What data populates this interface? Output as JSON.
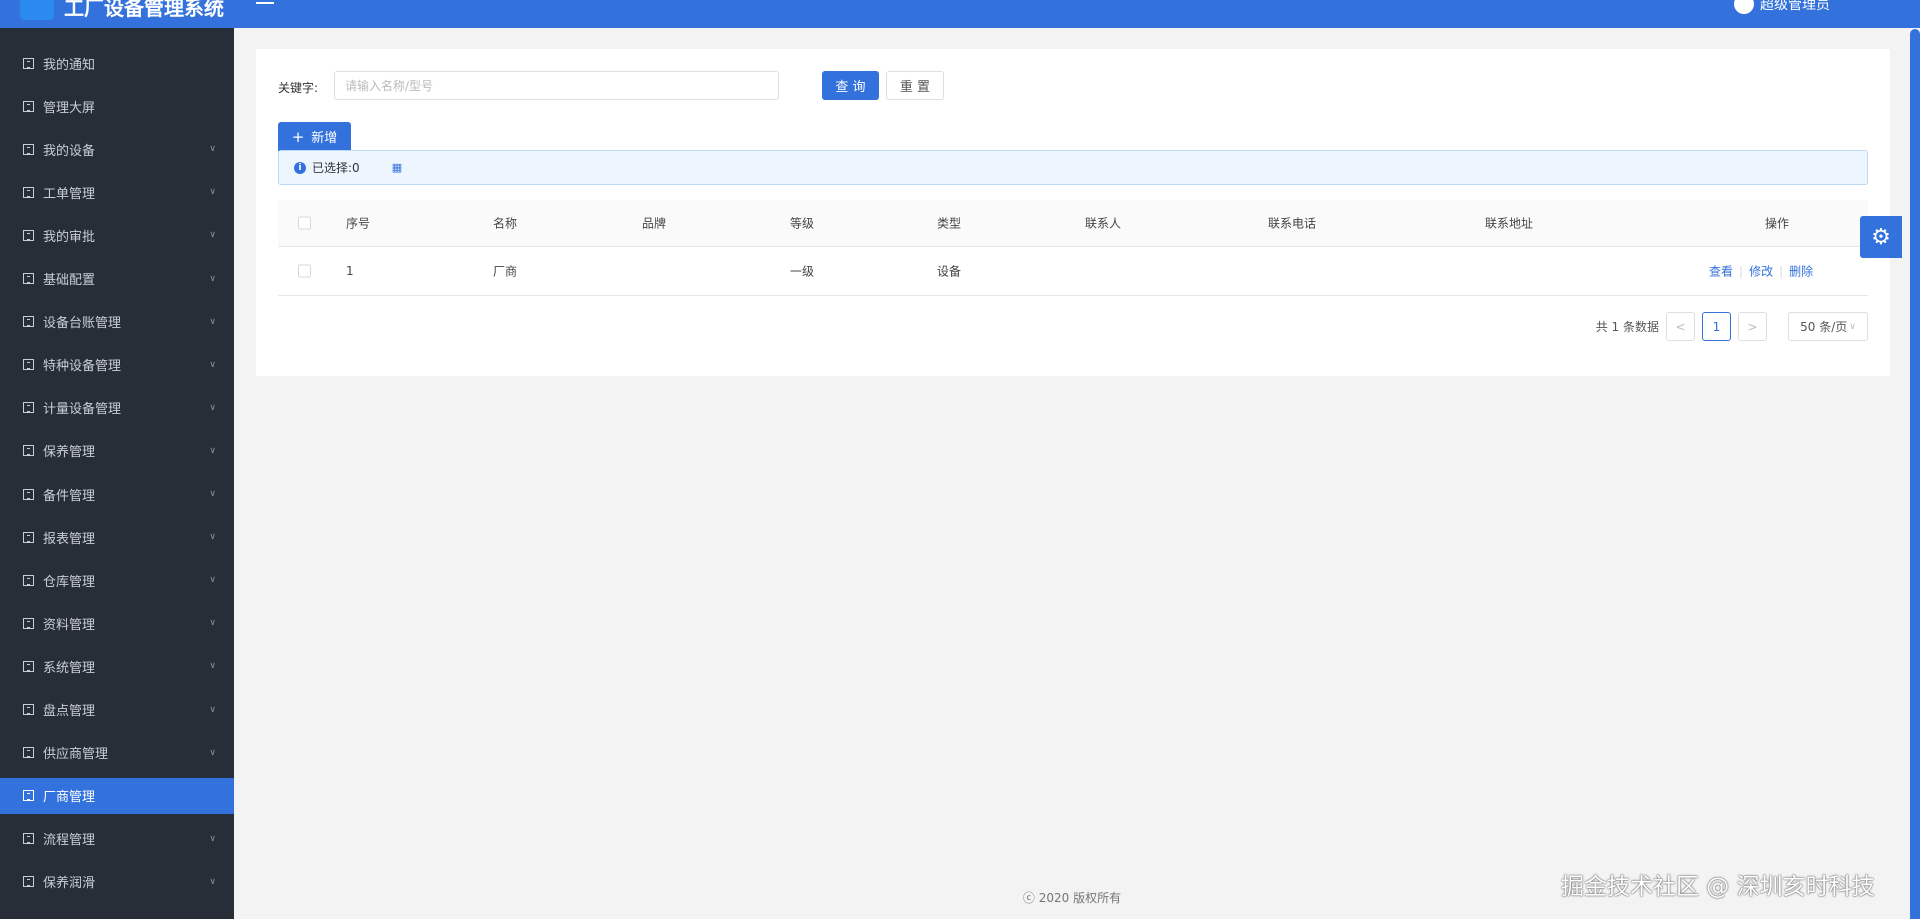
{
  "header": {
    "title": "工厂设备管理系统",
    "user": "超级管理员"
  },
  "sidebar": {
    "items": [
      {
        "label": "我的通知",
        "expandable": false
      },
      {
        "label": "管理大屏",
        "expandable": false
      },
      {
        "label": "我的设备",
        "expandable": true
      },
      {
        "label": "工单管理",
        "expandable": true
      },
      {
        "label": "我的审批",
        "expandable": true
      },
      {
        "label": "基础配置",
        "expandable": true
      },
      {
        "label": "设备台账管理",
        "expandable": true
      },
      {
        "label": "特种设备管理",
        "expandable": true
      },
      {
        "label": "计量设备管理",
        "expandable": true
      },
      {
        "label": "保养管理",
        "expandable": true
      },
      {
        "label": "备件管理",
        "expandable": true
      },
      {
        "label": "报表管理",
        "expandable": true
      },
      {
        "label": "仓库管理",
        "expandable": true
      },
      {
        "label": "资料管理",
        "expandable": true
      },
      {
        "label": "系统管理",
        "expandable": true
      },
      {
        "label": "盘点管理",
        "expandable": true
      },
      {
        "label": "供应商管理",
        "expandable": true
      },
      {
        "label": "厂商管理",
        "expandable": false,
        "active": true
      },
      {
        "label": "流程管理",
        "expandable": true
      },
      {
        "label": "保养润滑",
        "expandable": true
      }
    ]
  },
  "search": {
    "label": "关键字:",
    "placeholder": "请输入名称/型号",
    "value": "",
    "query": "查 询",
    "reset": "重 置"
  },
  "toolbar": {
    "add": "新增"
  },
  "alert": {
    "selected": "已选择:0"
  },
  "table": {
    "columns": [
      "序号",
      "名称",
      "品牌",
      "等级",
      "类型",
      "联系人",
      "联系电话",
      "联系地址",
      "操作"
    ],
    "rows": [
      {
        "cells": [
          "1",
          "厂商",
          "",
          "一级",
          "设备",
          "",
          "",
          ""
        ],
        "actions": [
          "查看",
          "修改",
          "删除"
        ]
      }
    ]
  },
  "pagination": {
    "total": "共 1 条数据",
    "prev": "<",
    "current": "1",
    "next": ">",
    "page_size": "50 条/页"
  },
  "footer": "ⓒ 2020 版权所有",
  "watermark": "掘金技术社区 @ 深圳亥时科技",
  "colors": {
    "accent": "#3372dc",
    "sidebar": "#272e38"
  }
}
